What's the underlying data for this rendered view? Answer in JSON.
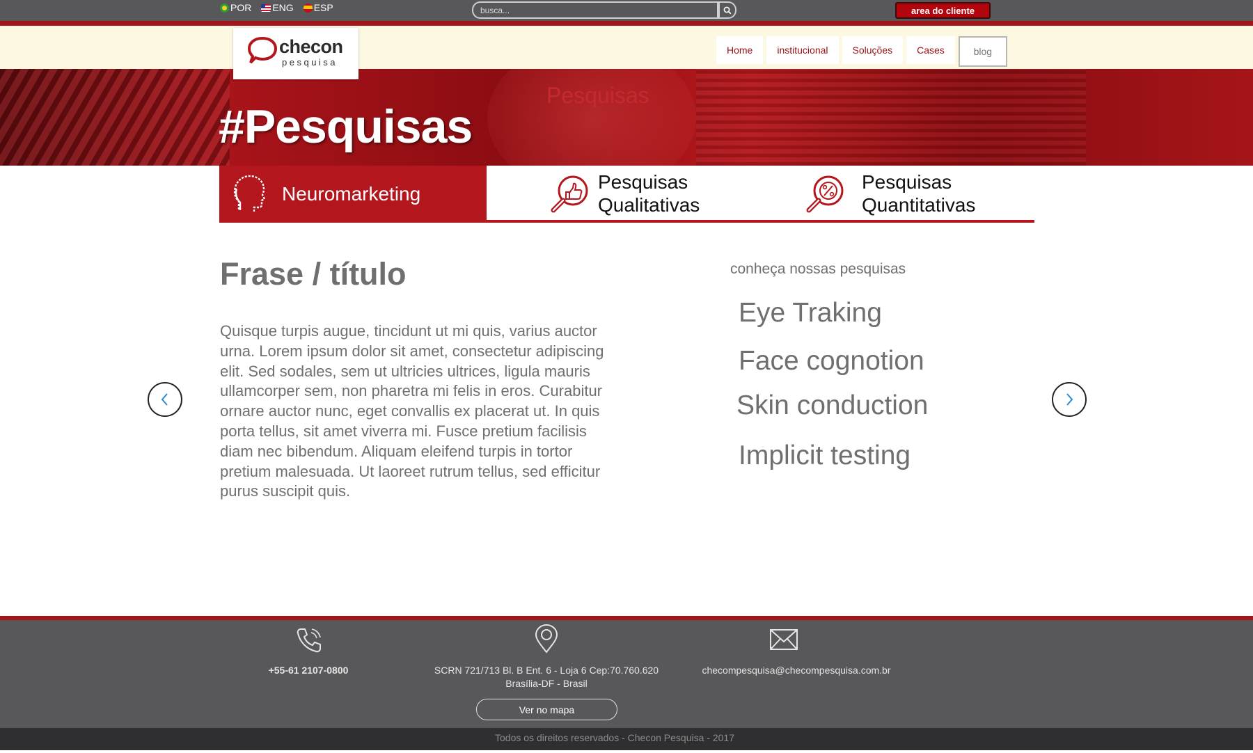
{
  "topbar": {
    "languages": [
      {
        "code": "POR",
        "flag": "brazil-flag-icon"
      },
      {
        "code": "ENG",
        "flag": "usa-flag-icon"
      },
      {
        "code": "ESP",
        "flag": "spain-flag-icon"
      }
    ],
    "search_placeholder": "busca...",
    "client_area_label": "area do cliente"
  },
  "logo": {
    "name": "checon",
    "sub": "pesquisa",
    "accent": "#b3161d"
  },
  "nav": {
    "items": [
      "Home",
      "institucional",
      "Soluções",
      "Cases",
      "blog"
    ]
  },
  "hero": {
    "ghost_text": "Pesquisas",
    "title": "#Pesquisas"
  },
  "tabs": [
    {
      "label": "Neuromarketing",
      "icon": "head-icon",
      "active": true
    },
    {
      "label_line1": "Pesquisas",
      "label_line2": "Qualitativas",
      "icon": "magnifier-thumbs-up-icon",
      "active": false
    },
    {
      "label_line1": "Pesquisas",
      "label_line2": "Quantitativas",
      "icon": "magnifier-percent-icon",
      "active": false
    }
  ],
  "content": {
    "title": "Frase  / título",
    "body": "Quisque turpis augue, tincidunt ut mi quis, varius auctor urna. Lorem ipsum dolor sit amet, consectetur adipiscing elit. Sed sodales, sem ut ultricies ultrices, ligula mauris ullamcorper sem, non pharetra mi felis in eros. Curabitur ornare auctor nunc, eget convallis ex placerat ut. In quis porta tellus, sit amet viverra mi. Fusce pretium facilisis diam nec bibendum. Aliquam eleifend turpis in tortor pretium malesuada. Ut laoreet rutrum tellus, sed efficitur purus suscipit quis."
  },
  "sidebar": {
    "title": "conheça nossas pesquisas",
    "items": [
      "Eye Traking",
      "Face cognotion",
      "Skin conduction",
      "Implicit testing"
    ]
  },
  "footer": {
    "phone": "+55-61 2107-0800",
    "address_line1": "SCRN 721/713 Bl. B Ent. 6 - Loja 6 Cep:70.760.620",
    "address_line2": "Brasília-DF - Brasil",
    "map_button": "Ver no mapa",
    "email": "checompesquisa@checompesquisa.com.br",
    "copyright": "Todos os direitos reservados - Checon Pesquisa - 2017"
  },
  "colors": {
    "brand_red": "#b3161d",
    "dark_gray": "#58585a",
    "cream": "#fdf8e1"
  }
}
